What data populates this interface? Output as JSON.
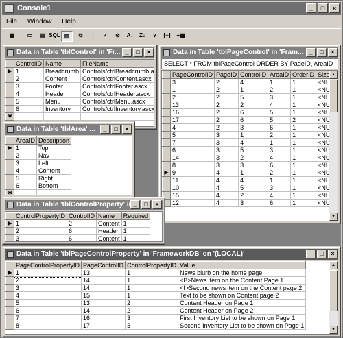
{
  "app": {
    "title": "Console1",
    "menu": [
      "File",
      "Window",
      "Help"
    ],
    "window_buttons": [
      "_",
      "□",
      "×"
    ]
  },
  "toolbar": [
    "show-pane-icon",
    "diagram-pane-icon",
    "grid-pane-icon",
    "sql-pane-icon",
    "results-pane-icon",
    "change-type-icon",
    "run-icon",
    "verify-sql-icon",
    "remove-filter-icon",
    "sort-ascending-icon",
    "sort-descending-icon",
    "filter-icon",
    "group-by-icon",
    "add-table-icon"
  ],
  "toolbar_labels": [
    "▦",
    "▭",
    "▤",
    "SQL",
    "▥",
    "⧉",
    "!",
    "✓",
    "⊘",
    "A↓",
    "Z↓",
    "⋎",
    "[≡]",
    "+▦"
  ],
  "windows": {
    "tblControl": {
      "title": "Data in Table 'tblControl' in 'Fr...",
      "columns": [
        "ControlID",
        "Name",
        "FileName"
      ],
      "rows": [
        [
          "1",
          "Breadcrumb",
          "Controls/ctrlBreadcrumb.ascx"
        ],
        [
          "2",
          "Content",
          "Controls/ctrlContent.ascx"
        ],
        [
          "3",
          "Footer",
          "Controls/ctrlFooter.ascx"
        ],
        [
          "4",
          "Header",
          "Controls/ctrlHeader.ascx"
        ],
        [
          "5",
          "Menu",
          "Controls/ctrlMenu.ascx"
        ],
        [
          "6",
          "Inventory",
          "Controls/ctrlInventory.ascx"
        ]
      ]
    },
    "tblPageControl": {
      "title": "Data in Table 'tblPageControl' in 'Fram...",
      "sql": "SELECT     * FROM         tblPageControl ORDER BY PageID, AreaID",
      "columns": [
        "PageControlID",
        "PageID",
        "ControlID",
        "AreaID",
        "OrderID",
        "Size"
      ],
      "rows": [
        [
          "3",
          "2",
          "4",
          "1",
          "1",
          "<NUL"
        ],
        [
          "1",
          "2",
          "1",
          "2",
          "1",
          "<NUL"
        ],
        [
          "2",
          "2",
          "5",
          "3",
          "1",
          "<NUL"
        ],
        [
          "13",
          "2",
          "2",
          "4",
          "1",
          "<NUL"
        ],
        [
          "16",
          "2",
          "6",
          "5",
          "1",
          "<NUL"
        ],
        [
          "17",
          "2",
          "6",
          "5",
          "2",
          "<NUL"
        ],
        [
          "4",
          "2",
          "3",
          "6",
          "1",
          "<NUL"
        ],
        [
          "5",
          "3",
          "1",
          "2",
          "1",
          "<NUL"
        ],
        [
          "7",
          "3",
          "4",
          "1",
          "1",
          "<NUL"
        ],
        [
          "6",
          "3",
          "5",
          "3",
          "1",
          "<NUL"
        ],
        [
          "14",
          "3",
          "2",
          "4",
          "1",
          "<NUL"
        ],
        [
          "8",
          "3",
          "3",
          "6",
          "1",
          "<NUL"
        ],
        [
          "9",
          "4",
          "1",
          "2",
          "1",
          "<NUL"
        ],
        [
          "11",
          "4",
          "4",
          "1",
          "1",
          "<NUL"
        ],
        [
          "10",
          "4",
          "5",
          "3",
          "1",
          "<NUL"
        ],
        [
          "15",
          "4",
          "2",
          "4",
          "1",
          "<NUL"
        ],
        [
          "12",
          "4",
          "3",
          "6",
          "1",
          "<NUL"
        ]
      ],
      "current_row": 12
    },
    "tblArea": {
      "title": "Data in Table 'tblArea' ...",
      "columns": [
        "AreaID",
        "Description"
      ],
      "rows": [
        [
          "1",
          "Top"
        ],
        [
          "2",
          "Nav"
        ],
        [
          "3",
          "Left"
        ],
        [
          "4",
          "Content"
        ],
        [
          "5",
          "Right"
        ],
        [
          "6",
          "Bottom"
        ]
      ]
    },
    "tblControlProperty": {
      "title": "Data in Table 'tblControlProperty' in 'Fr...",
      "columns": [
        "ControlPropertyID",
        "ControlID",
        "Name",
        "Required"
      ],
      "rows": [
        [
          "1",
          "2",
          "Content",
          "1"
        ],
        [
          "2",
          "6",
          "Header",
          "1"
        ],
        [
          "3",
          "6",
          "Content",
          "1"
        ]
      ]
    },
    "tblPageControlProperty": {
      "title": "Data in Table 'tblPageControlProperty' in 'FrameworkDB' on '(LOCAL)'",
      "columns": [
        "PageControlPropertyID",
        "PageControlID",
        "ControlPropertyID",
        "Value"
      ],
      "rows": [
        [
          "1",
          "13",
          "1",
          "News blurb on the home page"
        ],
        [
          "2",
          "14",
          "1",
          "<B>News item on the Content Page 1"
        ],
        [
          "3",
          "14",
          "1",
          "<I>Second news item on the Content page 2"
        ],
        [
          "4",
          "15",
          "1",
          "Text to be shown on Content page 2"
        ],
        [
          "5",
          "13",
          "2",
          "Content Header on Page 1"
        ],
        [
          "6",
          "14",
          "2",
          "Content Header on Page 2"
        ],
        [
          "7",
          "16",
          "3",
          "First Inventory List to be shown on Page 1"
        ],
        [
          "8",
          "17",
          "3",
          "Second Inventory List to be shown on Page 1"
        ]
      ]
    }
  }
}
